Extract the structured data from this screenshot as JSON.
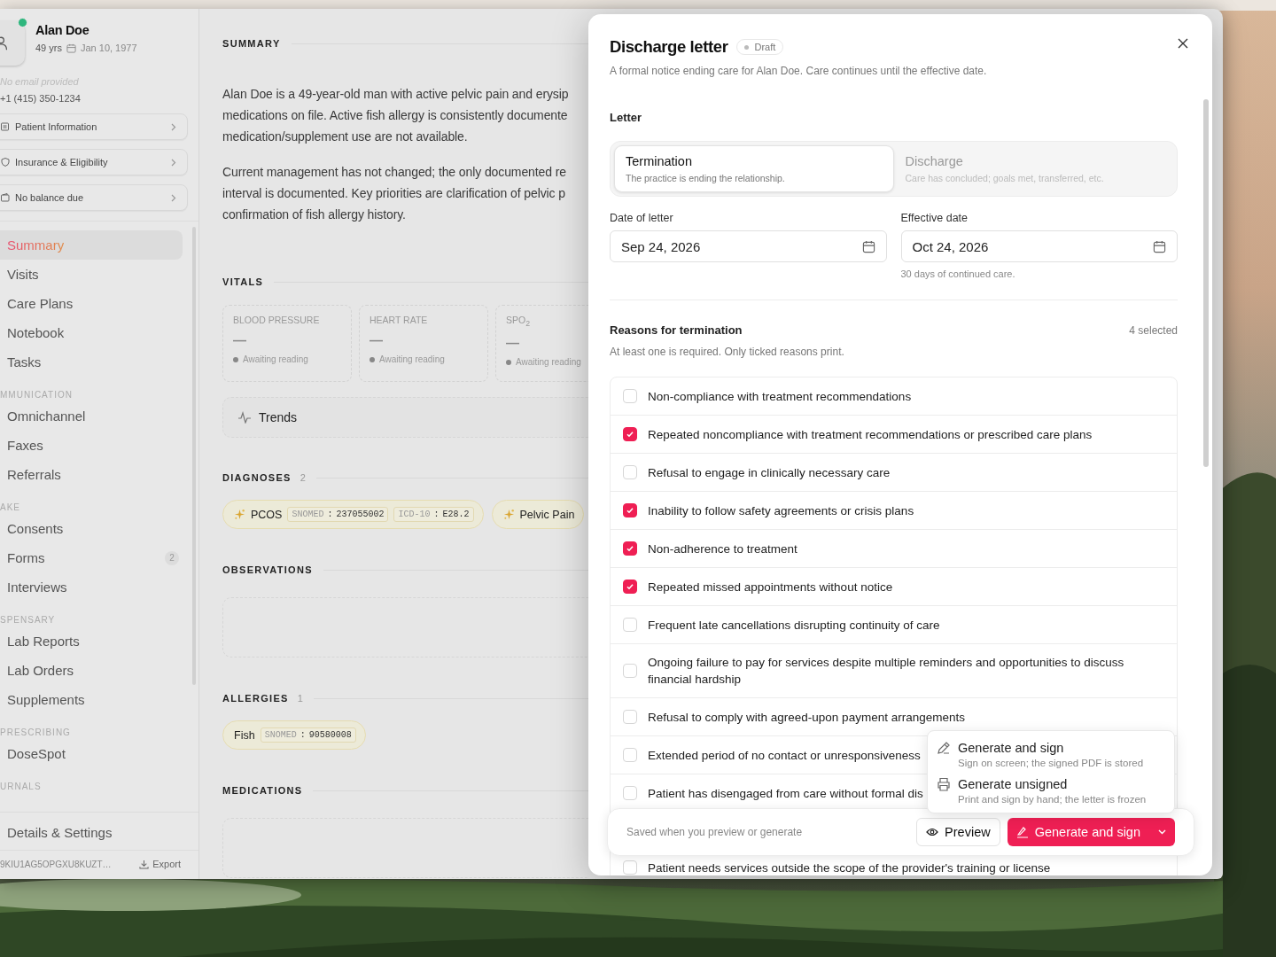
{
  "patient": {
    "name": "Alan Doe",
    "online": true,
    "age": "49 yrs",
    "dob": "Jan 10, 1977",
    "email_note": "No email provided",
    "phone": "+1 (415) 350-1234"
  },
  "patient_links": [
    {
      "label": "Patient Information",
      "kind": "info"
    },
    {
      "label": "Insurance & Eligibility",
      "kind": "insurance"
    },
    {
      "label": "No balance due",
      "kind": "billing"
    }
  ],
  "nav": [
    {
      "kind": "item",
      "label": "Summary",
      "selected": true
    },
    {
      "kind": "item",
      "label": "Visits",
      "selected": false
    },
    {
      "kind": "item",
      "label": "Care Plans",
      "selected": false
    },
    {
      "kind": "item",
      "label": "Notebook",
      "selected": false
    },
    {
      "kind": "item",
      "label": "Tasks",
      "selected": false
    },
    {
      "kind": "group",
      "label": "MMUNICATION"
    },
    {
      "kind": "item",
      "label": "Omnichannel",
      "selected": false
    },
    {
      "kind": "item",
      "label": "Faxes",
      "selected": false
    },
    {
      "kind": "item",
      "label": "Referrals",
      "selected": false
    },
    {
      "kind": "group",
      "label": "AKE"
    },
    {
      "kind": "item",
      "label": "Consents",
      "selected": false
    },
    {
      "kind": "item",
      "label": "Forms",
      "selected": false,
      "badge": "2"
    },
    {
      "kind": "item",
      "label": "Interviews",
      "selected": false
    },
    {
      "kind": "group",
      "label": "SPENSARY"
    },
    {
      "kind": "item",
      "label": "Lab Reports",
      "selected": false
    },
    {
      "kind": "item",
      "label": "Lab Orders",
      "selected": false
    },
    {
      "kind": "item",
      "label": "Supplements",
      "selected": false
    },
    {
      "kind": "group",
      "label": "PRESCRIBING"
    },
    {
      "kind": "item",
      "label": "DoseSpot",
      "selected": false
    },
    {
      "kind": "group",
      "label": "URNALS"
    }
  ],
  "sidebar_footer": {
    "settings": "Details & Settings",
    "record_id": "9KIU1AG5OPGXU8KUZT…",
    "export": "Export"
  },
  "summary": {
    "heading": "SUMMARY",
    "paragraphs": [
      "Alan Doe is a 49-year-old man with active pelvic pain and erysip\nmedications on file. Active fish allergy is consistently documente\nmedication/supplement use are not available.",
      "Current management has not changed; the only documented re\ninterval is documented. Key priorities are clarification of pelvic p\nconfirmation of fish allergy history."
    ]
  },
  "vitals": {
    "heading": "VITALS",
    "cards": [
      {
        "label": "BLOOD PRESSURE",
        "value": "—",
        "status": "Awaiting reading"
      },
      {
        "label": "HEART RATE",
        "value": "—",
        "status": "Awaiting reading"
      },
      {
        "label": "SPO$_{2}$",
        "value": "—",
        "status": "Awaiting reading"
      }
    ],
    "trends": "Trends"
  },
  "diagnoses": {
    "heading": "DIAGNOSES",
    "count": "2",
    "chips": [
      {
        "label": "PCOS",
        "codes": [
          {
            "system": "SNOMED",
            "separator": ":",
            "code": "237055002"
          },
          {
            "system": "ICD-10",
            "separator": ":",
            "code": "E28.2"
          }
        ]
      },
      {
        "label": "Pelvic Pain"
      }
    ]
  },
  "observations": {
    "heading": "OBSERVATIONS"
  },
  "allergies": {
    "heading": "ALLERGIES",
    "count": "1",
    "chips": [
      {
        "label": "Fish",
        "codes": [
          {
            "system": "SNOMED",
            "separator": ":",
            "code": "90580008"
          }
        ]
      }
    ]
  },
  "medications": {
    "heading": "MEDICATIONS"
  },
  "dialog": {
    "title": "Discharge letter",
    "status": "Draft",
    "subtitle": "A formal notice ending care for Alan Doe. Care continues until the effective date.",
    "letter_label": "Letter",
    "letter_types": [
      {
        "title": "Termination",
        "description": "The practice is ending the relationship.",
        "selected": true
      },
      {
        "title": "Discharge",
        "description": "Care has concluded; goals met, transferred, etc.",
        "selected": false
      }
    ],
    "date_fields": [
      {
        "label": "Date of letter",
        "value": "Sep 24, 2026"
      },
      {
        "label": "Effective date",
        "value": "Oct 24, 2026",
        "hint": "30 days of continued care."
      }
    ],
    "reasons_title": "Reasons for termination",
    "reasons_count": "4 selected",
    "reasons_hint": "At least one is required. Only ticked reasons print.",
    "reasons": [
      {
        "label": "Non-compliance with treatment recommendations",
        "checked": false
      },
      {
        "label": "Repeated noncompliance with treatment recommendations or prescribed care plans",
        "checked": true
      },
      {
        "label": "Refusal to engage in clinically necessary care",
        "checked": false
      },
      {
        "label": "Inability to follow safety agreements or crisis plans",
        "checked": true
      },
      {
        "label": "Non-adherence to treatment",
        "checked": true
      },
      {
        "label": "Repeated missed appointments without notice",
        "checked": true
      },
      {
        "label": "Frequent late cancellations disrupting continuity of care",
        "checked": false
      },
      {
        "label": "Ongoing failure to pay for services despite multiple reminders and opportunities to discuss financial hardship",
        "checked": false
      },
      {
        "label": "Refusal to comply with agreed-upon payment arrangements",
        "checked": false
      },
      {
        "label": "Extended period of no contact or unresponsiveness",
        "checked": false
      },
      {
        "label": "Patient has disengaged from care without formal dis",
        "checked": false
      },
      {
        "label": "Patient needs services outside the scope of the provider's training or license",
        "checked": false
      }
    ],
    "footer_note": "Saved when you preview or generate",
    "preview": "Preview",
    "primary": "Generate and sign",
    "menu": [
      {
        "kind": "sign",
        "title": "Generate and sign",
        "description": "Sign on screen; the signed PDF is stored"
      },
      {
        "kind": "print",
        "title": "Generate unsigned",
        "description": "Print and sign by hand; the letter is frozen"
      }
    ]
  }
}
